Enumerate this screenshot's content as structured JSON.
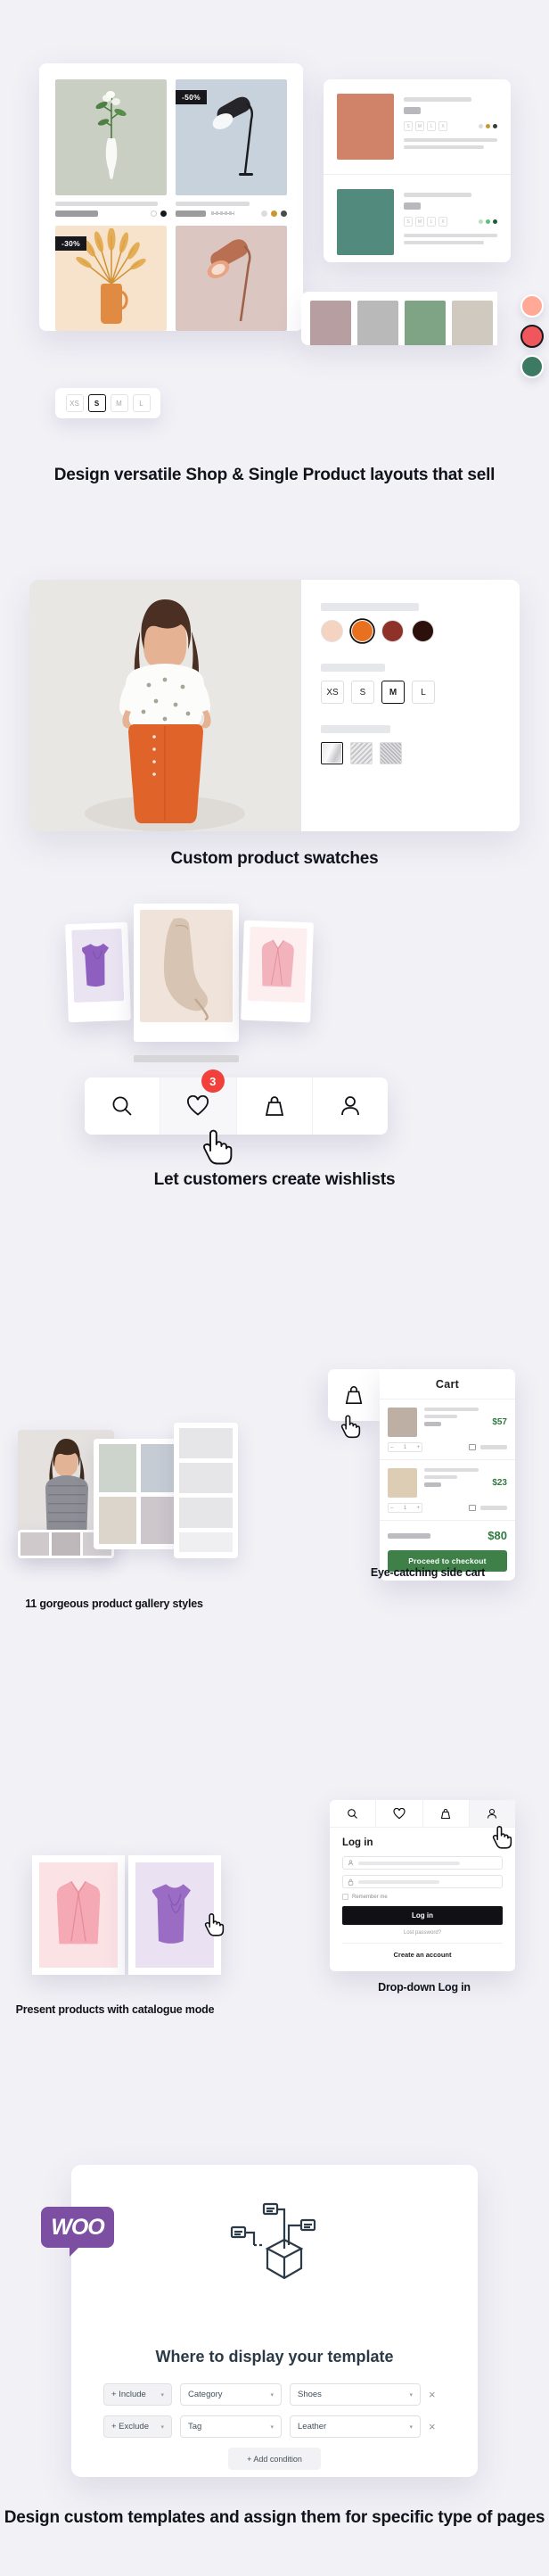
{
  "theme": {
    "bg": "#f2f1f6",
    "accent_red": "#f2403a",
    "accent_green": "#3f8049",
    "woo_purple": "#7c4fa3",
    "ink": "#11131a"
  },
  "section_shop": {
    "products": [
      {
        "name": "flower-vase-sage",
        "badge": "",
        "bg": "#c9cfc2",
        "swatches": [
          "#ffffff",
          "#17171c"
        ]
      },
      {
        "name": "black-desk-lamp",
        "badge": "-50%",
        "bg": "#c8d2dc",
        "swatches": [
          "#d9dde0",
          "#c9972f",
          "#4a4a4a"
        ]
      },
      {
        "name": "pampas-vase-peach",
        "badge": "-30%",
        "bg": "#f7e2cb",
        "swatches": []
      },
      {
        "name": "copper-lamp-rose",
        "badge": "",
        "bg": "#dbc6c2",
        "swatches": []
      }
    ],
    "list_items": [
      {
        "thumb": "#d08368",
        "sizes": [
          "S",
          "M",
          "L",
          "XL"
        ],
        "colors": [
          "#dcdcdf",
          "#c9972f",
          "#3b3b3b"
        ]
      },
      {
        "thumb": "#528b7d",
        "sizes": [
          "S",
          "M",
          "L",
          "XL"
        ],
        "colors": [
          "#b7e0c4",
          "#5bbd7e",
          "#1c5c35"
        ]
      }
    ],
    "palette_strip": [
      "#b79ea0",
      "#b9b9b9",
      "#7ea485"
    ],
    "pills": [
      "#ffa996",
      "#f0575c",
      "#3c7a63"
    ],
    "size_selector": {
      "options": [
        "XS",
        "S",
        "M",
        "L"
      ],
      "selected": "S"
    },
    "caption": "Design versatile Shop & Single Product layouts that sell"
  },
  "section_swatches": {
    "colors": {
      "options": [
        "#f4d3c0",
        "#e8701f",
        "#8e3229",
        "#2b100c"
      ],
      "selected_index": 1
    },
    "sizes": {
      "options": [
        "XS",
        "S",
        "M",
        "L"
      ],
      "selected": "M"
    },
    "textures": {
      "options": [
        "satin",
        "chevron",
        "tweed"
      ],
      "selected_index": 0
    },
    "caption": "Custom product swatches"
  },
  "section_wishlist": {
    "icons": [
      "search-icon",
      "heart-icon",
      "bag-icon",
      "user-icon"
    ],
    "active_icon": "heart-icon",
    "badge_count": "3",
    "polaroids": [
      "#8f5fbf",
      "#d8c4b2",
      "#f2b3bc"
    ],
    "caption": "Let customers create wishlists"
  },
  "section_cart": {
    "title": "Cart",
    "items": [
      {
        "thumb": "#bdafa4",
        "price": "$57"
      },
      {
        "thumb": "#ddcdb4",
        "price": "$23"
      }
    ],
    "total": "$80",
    "checkout_label": "Proceed to checkout",
    "caption": "Eye-catching side cart",
    "gallery_caption": "11 gorgeous product gallery styles"
  },
  "section_login": {
    "icons": [
      "search-icon",
      "heart-icon",
      "bag-icon",
      "user-icon"
    ],
    "active_icon": "user-icon",
    "heading": "Log in",
    "username_placeholder": "",
    "password_placeholder": "",
    "remember_label": "Remember me",
    "submit_label": "Log in",
    "lost_password_label": "Lost password?",
    "create_account_label": "Create an account",
    "caption": "Drop-down Log in",
    "catalogue_caption": "Present products with catalogue mode"
  },
  "section_woo": {
    "logo_text": "WOO",
    "title": "Where to display your template",
    "conditions": [
      {
        "mode": "+  Include",
        "type": "Category",
        "value": "Shoes",
        "remove": "×"
      },
      {
        "mode": "+  Exclude",
        "type": "Tag",
        "value": "Leather",
        "remove": "×"
      }
    ],
    "add_condition_label": "+  Add condition",
    "chevron": "⌄",
    "caption": "Design custom templates and assign them for specific type of pages"
  }
}
